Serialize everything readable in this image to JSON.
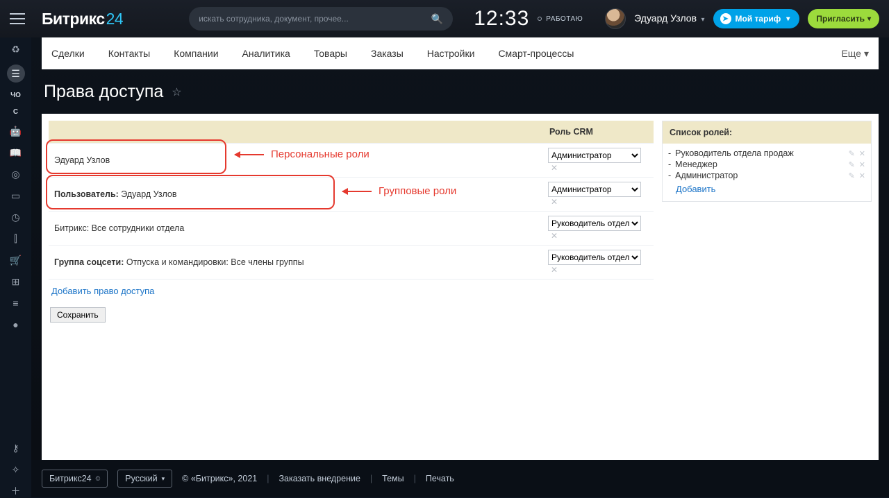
{
  "header": {
    "logo_main": "Битрикс",
    "logo_suffix": "24",
    "search_placeholder": "искать сотрудника, документ, прочее...",
    "clock": "12:33",
    "status": "РАБОТАЮ",
    "user_name": "Эдуард Узлов",
    "tariff_label": "Мой тариф",
    "invite_label": "Пригласить"
  },
  "tabs": [
    "Сделки",
    "Контакты",
    "Компании",
    "Аналитика",
    "Товары",
    "Заказы",
    "Настройки",
    "Смарт-процессы"
  ],
  "tabs_more": "Еще",
  "page_title": "Права доступа",
  "perm_table": {
    "header_name": "",
    "header_role": "Роль CRM",
    "rows": [
      {
        "text": "Эдуард Узлов",
        "label": "",
        "role": "Администратор"
      },
      {
        "text": "Эдуард Узлов",
        "label": "Пользователь:",
        "role": "Администратор"
      },
      {
        "text": "Битрикс: Все сотрудники отдела",
        "label": "",
        "role": "Руководитель отдела продаж"
      },
      {
        "text": "Отпуска и командировки: Все члены группы",
        "label": "Группа соцсети:",
        "role": "Руководитель отдела продаж"
      }
    ],
    "role_options": [
      "Администратор",
      "Менеджер",
      "Руководитель отдела продаж"
    ]
  },
  "add_permission": "Добавить право доступа",
  "save": "Сохранить",
  "roles_panel": {
    "title": "Список ролей:",
    "items": [
      "Руководитель отдела продаж",
      "Менеджер",
      "Администратор"
    ],
    "add": "Добавить"
  },
  "annotations": {
    "personal": "Персональные роли",
    "group": "Групповые роли"
  },
  "footer": {
    "brand": "Битрикс24",
    "lang": "Русский",
    "copyright": "© «Битрикс», 2021",
    "links": [
      "Заказать внедрение",
      "Темы",
      "Печать"
    ]
  },
  "left_rail_text": [
    "ЧО",
    "С"
  ]
}
